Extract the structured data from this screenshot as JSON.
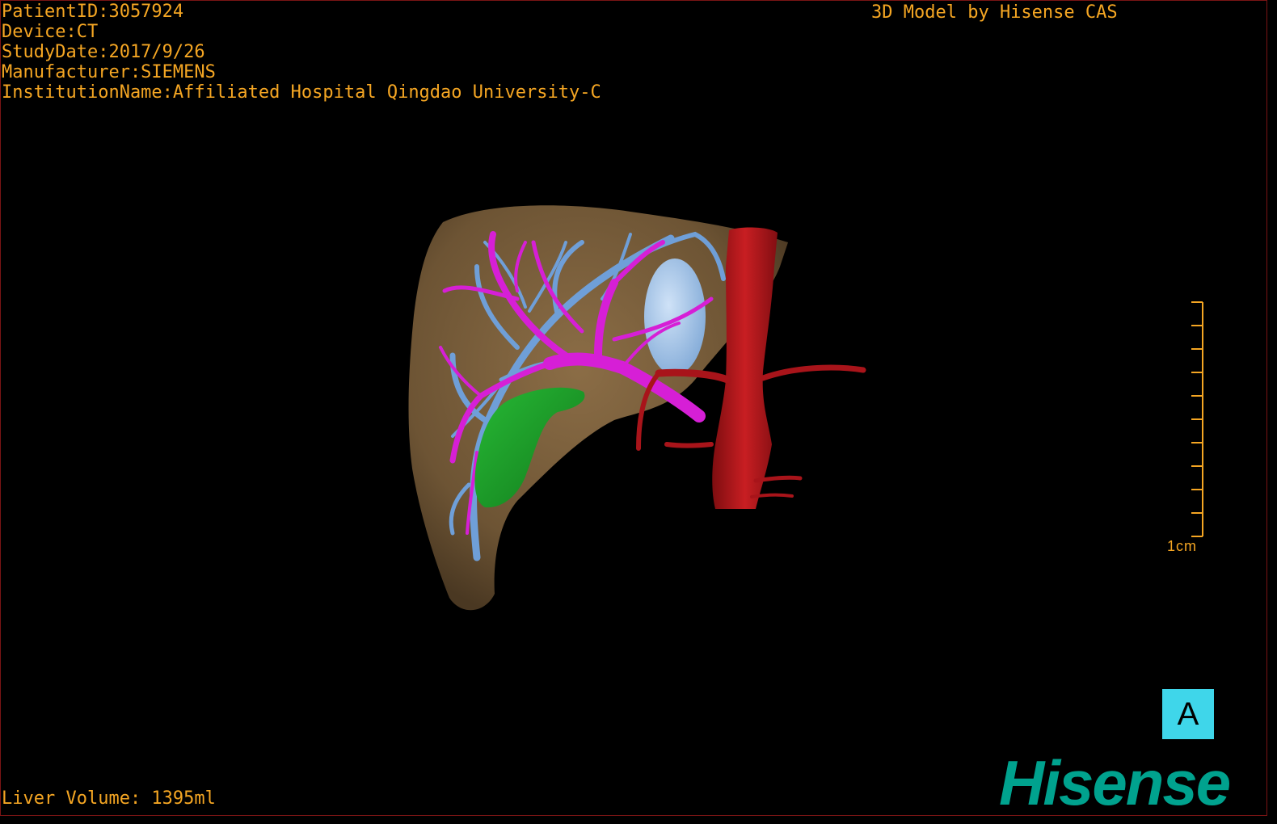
{
  "header": {
    "patient_id": "PatientID:3057924",
    "device": "Device:CT",
    "study_date": "StudyDate:2017/9/26",
    "manufacturer": "Manufacturer:SIEMENS",
    "institution": "InstitutionName:Affiliated Hospital Qingdao University-C"
  },
  "credit": "3D Model by Hisense CAS",
  "footer": {
    "liver_volume": "Liver Volume: 1395ml"
  },
  "scale": {
    "label": "1cm"
  },
  "view_badge": "A",
  "logo": "Hisense",
  "colors": {
    "text": "#f5a623",
    "liver": "#7a5f3d",
    "portal_vein": "#d61fd6",
    "hepatic_vein": "#6f9fd8",
    "tumor": "#9fc6ee",
    "gallbladder": "#1e9e2a",
    "artery": "#b0141a",
    "badge": "#3fd6ea",
    "logo": "#00a28e"
  }
}
